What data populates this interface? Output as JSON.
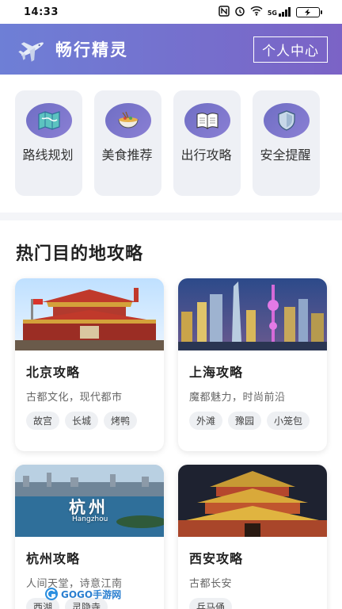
{
  "status_bar": {
    "time": "14:33",
    "network": "5G",
    "battery": ""
  },
  "header": {
    "app_title": "畅行精灵",
    "profile_button": "个人中心",
    "logo_icon": "airplane-icon"
  },
  "features": [
    {
      "label": "路线规划",
      "icon": "map-icon"
    },
    {
      "label": "美食推荐",
      "icon": "food-bowl-icon"
    },
    {
      "label": "出行攻略",
      "icon": "book-icon"
    },
    {
      "label": "安全提醒",
      "icon": "shield-icon"
    }
  ],
  "section": {
    "title": "热门目的地攻略"
  },
  "destinations": [
    {
      "name": "北京攻略",
      "desc": "古都文化，现代都市",
      "tags": [
        "故宫",
        "长城",
        "烤鸭"
      ],
      "image": "beijing-tiananmen"
    },
    {
      "name": "上海攻略",
      "desc": "魔都魅力，时尚前沿",
      "tags": [
        "外滩",
        "豫园",
        "小笼包"
      ],
      "image": "shanghai-skyline"
    },
    {
      "name": "杭州攻略",
      "desc": "人间天堂，诗意江南",
      "tags": [
        "西湖",
        "灵隐寺"
      ],
      "image_text": "杭州",
      "image_subtext": "Hangzhou",
      "image": "hangzhou-westlake"
    },
    {
      "name": "西安攻略",
      "desc": "古都长安",
      "tags": [
        "兵马俑"
      ],
      "image": "xian-bell-tower"
    }
  ],
  "watermark": {
    "text": "GOGO手游网"
  },
  "colors": {
    "header_start": "#6e7fd6",
    "header_end": "#7b63c6",
    "icon_bg": "#7570c8"
  }
}
